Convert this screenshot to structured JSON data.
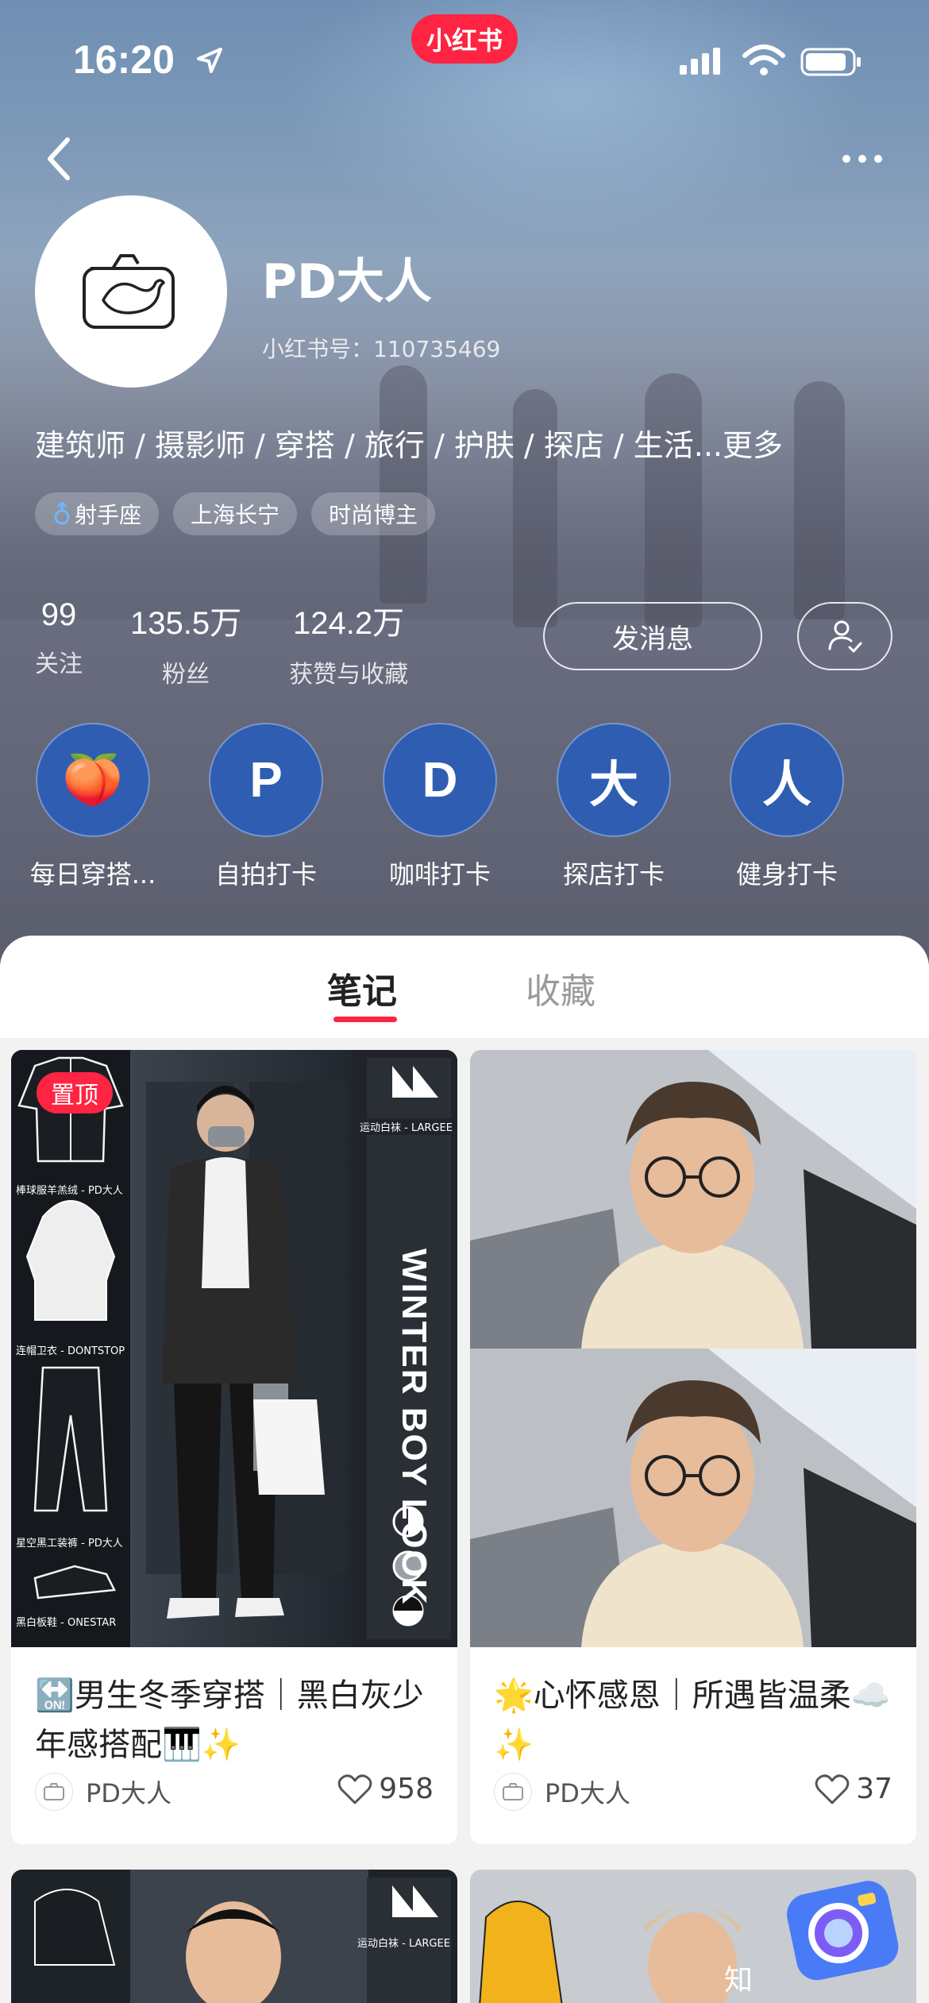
{
  "status_bar": {
    "time": "16:20"
  },
  "brand": {
    "badge": "小红书"
  },
  "profile": {
    "nickname": "PD大人",
    "id_line": "小红书号：110735469",
    "bio": "建筑师 / 摄影师 / 穿搭 / 旅行 / 护肤 / 探店 / 生活...更多",
    "tags": [
      "射手座",
      "上海长宁",
      "时尚博主"
    ]
  },
  "stats": [
    {
      "value": "99",
      "label": "关注"
    },
    {
      "value": "135.5万",
      "label": "粉丝"
    },
    {
      "value": "124.2万",
      "label": "获赞与收藏"
    }
  ],
  "actions": {
    "message": "发消息"
  },
  "collections": [
    {
      "glyph": "🍑",
      "label": "每日穿搭..."
    },
    {
      "glyph": "P",
      "label": "自拍打卡"
    },
    {
      "glyph": "D",
      "label": "咖啡打卡"
    },
    {
      "glyph": "大",
      "label": "探店打卡"
    },
    {
      "glyph": "人",
      "label": "健身打卡"
    }
  ],
  "tabs": {
    "notes": "笔记",
    "favorites": "收藏"
  },
  "notes": [
    {
      "pinned": "置顶",
      "title": "🔛男生冬季穿搭｜黑白灰少年感搭配🎹✨",
      "author": "PD大人",
      "likes": "958",
      "poster_text": "WINTER BOY LOOK",
      "labels": [
        "运动白袜 - LARGEE",
        "棒球服羊羔绒 - PD大人",
        "连帽卫衣 - DONTSTOP",
        "星空黑工装裤 - PD大人",
        "黑白板鞋 - ONESTAR"
      ]
    },
    {
      "title": "🌟心怀感恩｜所遇皆温柔☁️✨",
      "author": "PD大人",
      "likes": "37"
    }
  ],
  "bottom_cards": {
    "left_label": "运动白袜 - LARGEE",
    "right_label": "知"
  },
  "colors": {
    "accent": "#ff2442",
    "collection_blue": "#2f5db2"
  }
}
